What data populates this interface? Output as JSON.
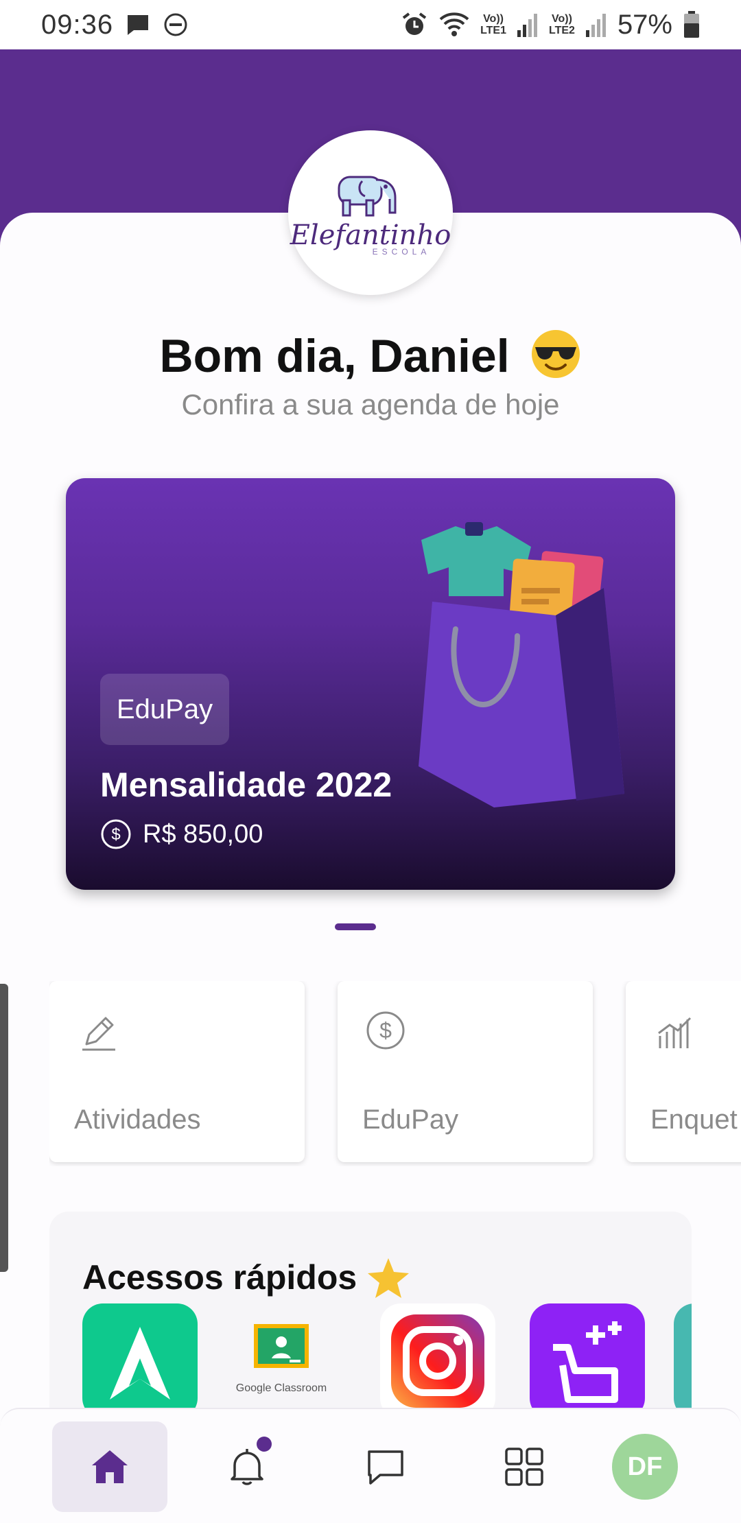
{
  "status_bar": {
    "time": "09:36",
    "battery_percent": "57%",
    "sim1_label_top": "Vo))",
    "sim1_label_bottom": "LTE1",
    "sim2_label_top": "Vo))",
    "sim2_label_bottom": "LTE2",
    "icons": [
      "message-icon",
      "do-not-disturb-icon",
      "alarm-icon",
      "wifi-icon",
      "signal-icon",
      "battery-icon"
    ]
  },
  "header": {
    "logo_name": "Elefantinho",
    "logo_sub": "ESCOLA",
    "greeting": "Bom dia, Daniel",
    "greeting_emoji": "sunglasses-emoji",
    "subtitle": "Confira a sua agenda de hoje"
  },
  "banner": {
    "tag": "EduPay",
    "title": "Mensalidade 2022",
    "amount": "R$ 850,00",
    "active_page": 1
  },
  "features": [
    {
      "label": "Atividades",
      "icon": "pencil-icon"
    },
    {
      "label": "EduPay",
      "icon": "dollar-circle-icon"
    },
    {
      "label": "Enquet",
      "icon": "bar-chart-icon"
    }
  ],
  "quick_access": {
    "title": "Acessos rápidos",
    "apps": [
      {
        "name": "app-a",
        "icon": "a-logo-icon",
        "color": "#0ec98d"
      },
      {
        "name": "google-classroom",
        "label": "Google Classroom",
        "icon": "google-classroom-icon"
      },
      {
        "name": "instagram",
        "icon": "instagram-icon"
      },
      {
        "name": "app-purple",
        "icon": "board-plus-icon",
        "color": "#8e22f5"
      },
      {
        "name": "app-teal",
        "icon": "teal-app-icon",
        "color": "#47b8b0"
      }
    ]
  },
  "bottom_nav": {
    "items": [
      "home-icon",
      "bell-icon",
      "chat-icon",
      "grid-icon",
      "avatar"
    ],
    "avatar_initials": "DF"
  },
  "colors": {
    "brand": "#5b2d8e",
    "avatar": "#9ed69a"
  }
}
